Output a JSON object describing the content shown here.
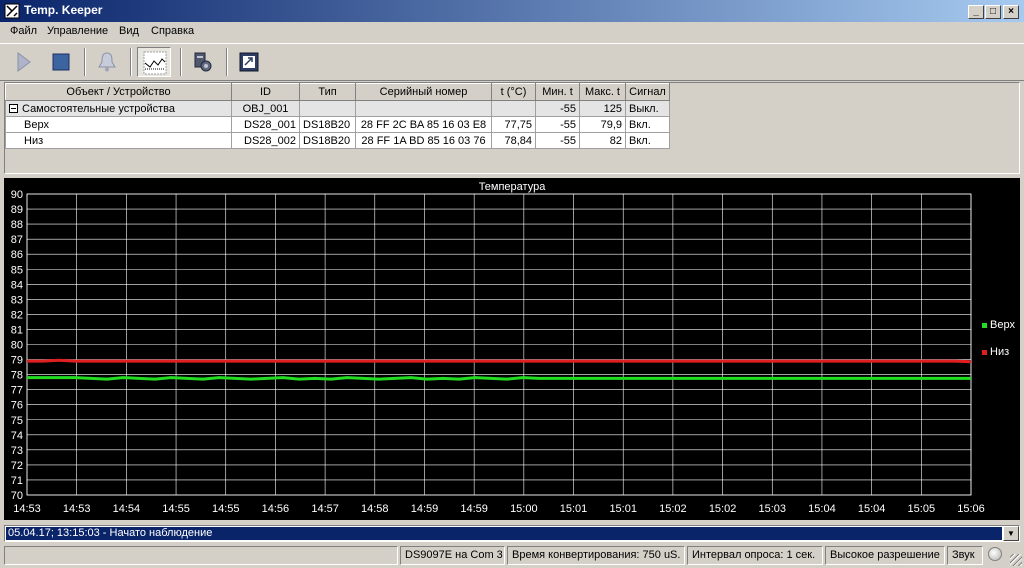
{
  "window": {
    "title": "Temp. Keeper"
  },
  "menu": [
    "Файл",
    "Управление",
    "Вид",
    "Справка"
  ],
  "toolbar": {
    "buttons": [
      {
        "name": "play-icon",
        "x": 6
      },
      {
        "name": "stop-icon",
        "x": 44
      },
      {
        "name": "bell-icon",
        "x": 90
      },
      {
        "name": "chart-icon",
        "x": 138
      },
      {
        "name": "settings-icon",
        "x": 186
      },
      {
        "name": "export-icon",
        "x": 232
      }
    ]
  },
  "table": {
    "columns": [
      "Объект / Устройство",
      "ID",
      "Тип",
      "Серийный номер",
      "t (°C)",
      "Мин. t",
      "Макс. t",
      "Сигнал"
    ],
    "rows": [
      {
        "object": "Самостоятельные устройства",
        "id": "OBJ_001",
        "type": "",
        "serial": "",
        "t": "",
        "min": "-55",
        "max": "125",
        "signal": "Выкл."
      },
      {
        "object": "Верх",
        "id": "DS28_001",
        "type": "DS18B20",
        "serial": "28 FF 2C BA 85 16 03 E8",
        "t": "77,75",
        "min": "-55",
        "max": "79,9",
        "signal": "Вкл."
      },
      {
        "object": "Низ",
        "id": "DS28_002",
        "type": "DS18B20",
        "serial": "28 FF 1A BD 85 16 03 76",
        "t": "78,84",
        "min": "-55",
        "max": "82",
        "signal": "Вкл."
      }
    ]
  },
  "chart_data": {
    "type": "line",
    "title": "Температура",
    "ylim": [
      70,
      90
    ],
    "yticks": [
      70,
      71,
      72,
      73,
      74,
      75,
      76,
      77,
      78,
      79,
      80,
      81,
      82,
      83,
      84,
      85,
      86,
      87,
      88,
      89,
      90
    ],
    "xticks": [
      "14:53",
      "14:53",
      "14:54",
      "14:55",
      "14:55",
      "14:56",
      "14:57",
      "14:58",
      "14:59",
      "14:59",
      "15:00",
      "15:01",
      "15:01",
      "15:02",
      "15:02",
      "15:03",
      "15:04",
      "15:04",
      "15:05",
      "15:06"
    ],
    "grid": true,
    "legend": "right",
    "series": [
      {
        "name": "Верх",
        "color": "#22dd22",
        "values": [
          77.8,
          77.8,
          77.8,
          77.8,
          77.75,
          77.7,
          77.8,
          77.75,
          77.7,
          77.8,
          77.75,
          77.7,
          77.8,
          77.75,
          77.7,
          77.75,
          77.8,
          77.7,
          77.75,
          77.7,
          77.8,
          77.75,
          77.7,
          77.75,
          77.8,
          77.7,
          77.75,
          77.7,
          77.8,
          77.75,
          77.7,
          77.8,
          77.75,
          77.75,
          77.75,
          77.75,
          77.75,
          77.75,
          77.75,
          77.75,
          77.75,
          77.75,
          77.75,
          77.75,
          77.75,
          77.75,
          77.75,
          77.75,
          77.75,
          77.75,
          77.75,
          77.75,
          77.75,
          77.75,
          77.75,
          77.75,
          77.75,
          77.75,
          77.75,
          77.75
        ]
      },
      {
        "name": "Низ",
        "color": "#e02020",
        "values": [
          78.9,
          78.9,
          78.95,
          78.9,
          78.9,
          78.9,
          78.9,
          78.9,
          78.9,
          78.9,
          78.9,
          78.9,
          78.9,
          78.9,
          78.9,
          78.9,
          78.9,
          78.9,
          78.9,
          78.9,
          78.9,
          78.9,
          78.9,
          78.9,
          78.9,
          78.9,
          78.9,
          78.9,
          78.9,
          78.9,
          78.9,
          78.9,
          78.9,
          78.9,
          78.9,
          78.9,
          78.9,
          78.9,
          78.9,
          78.9,
          78.9,
          78.9,
          78.9,
          78.9,
          78.9,
          78.9,
          78.9,
          78.9,
          78.9,
          78.9,
          78.9,
          78.9,
          78.9,
          78.9,
          78.9,
          78.9,
          78.9,
          78.9,
          78.9,
          78.85
        ]
      }
    ]
  },
  "log": {
    "text": "05.04.17; 13:15:03 - Начато наблюдение"
  },
  "status": [
    "DS9097E на Com 3",
    "Время конвертирования: 750 uS.",
    "Интервал опроса: 1 сек.",
    "Высокое разрешение",
    "Звук"
  ]
}
